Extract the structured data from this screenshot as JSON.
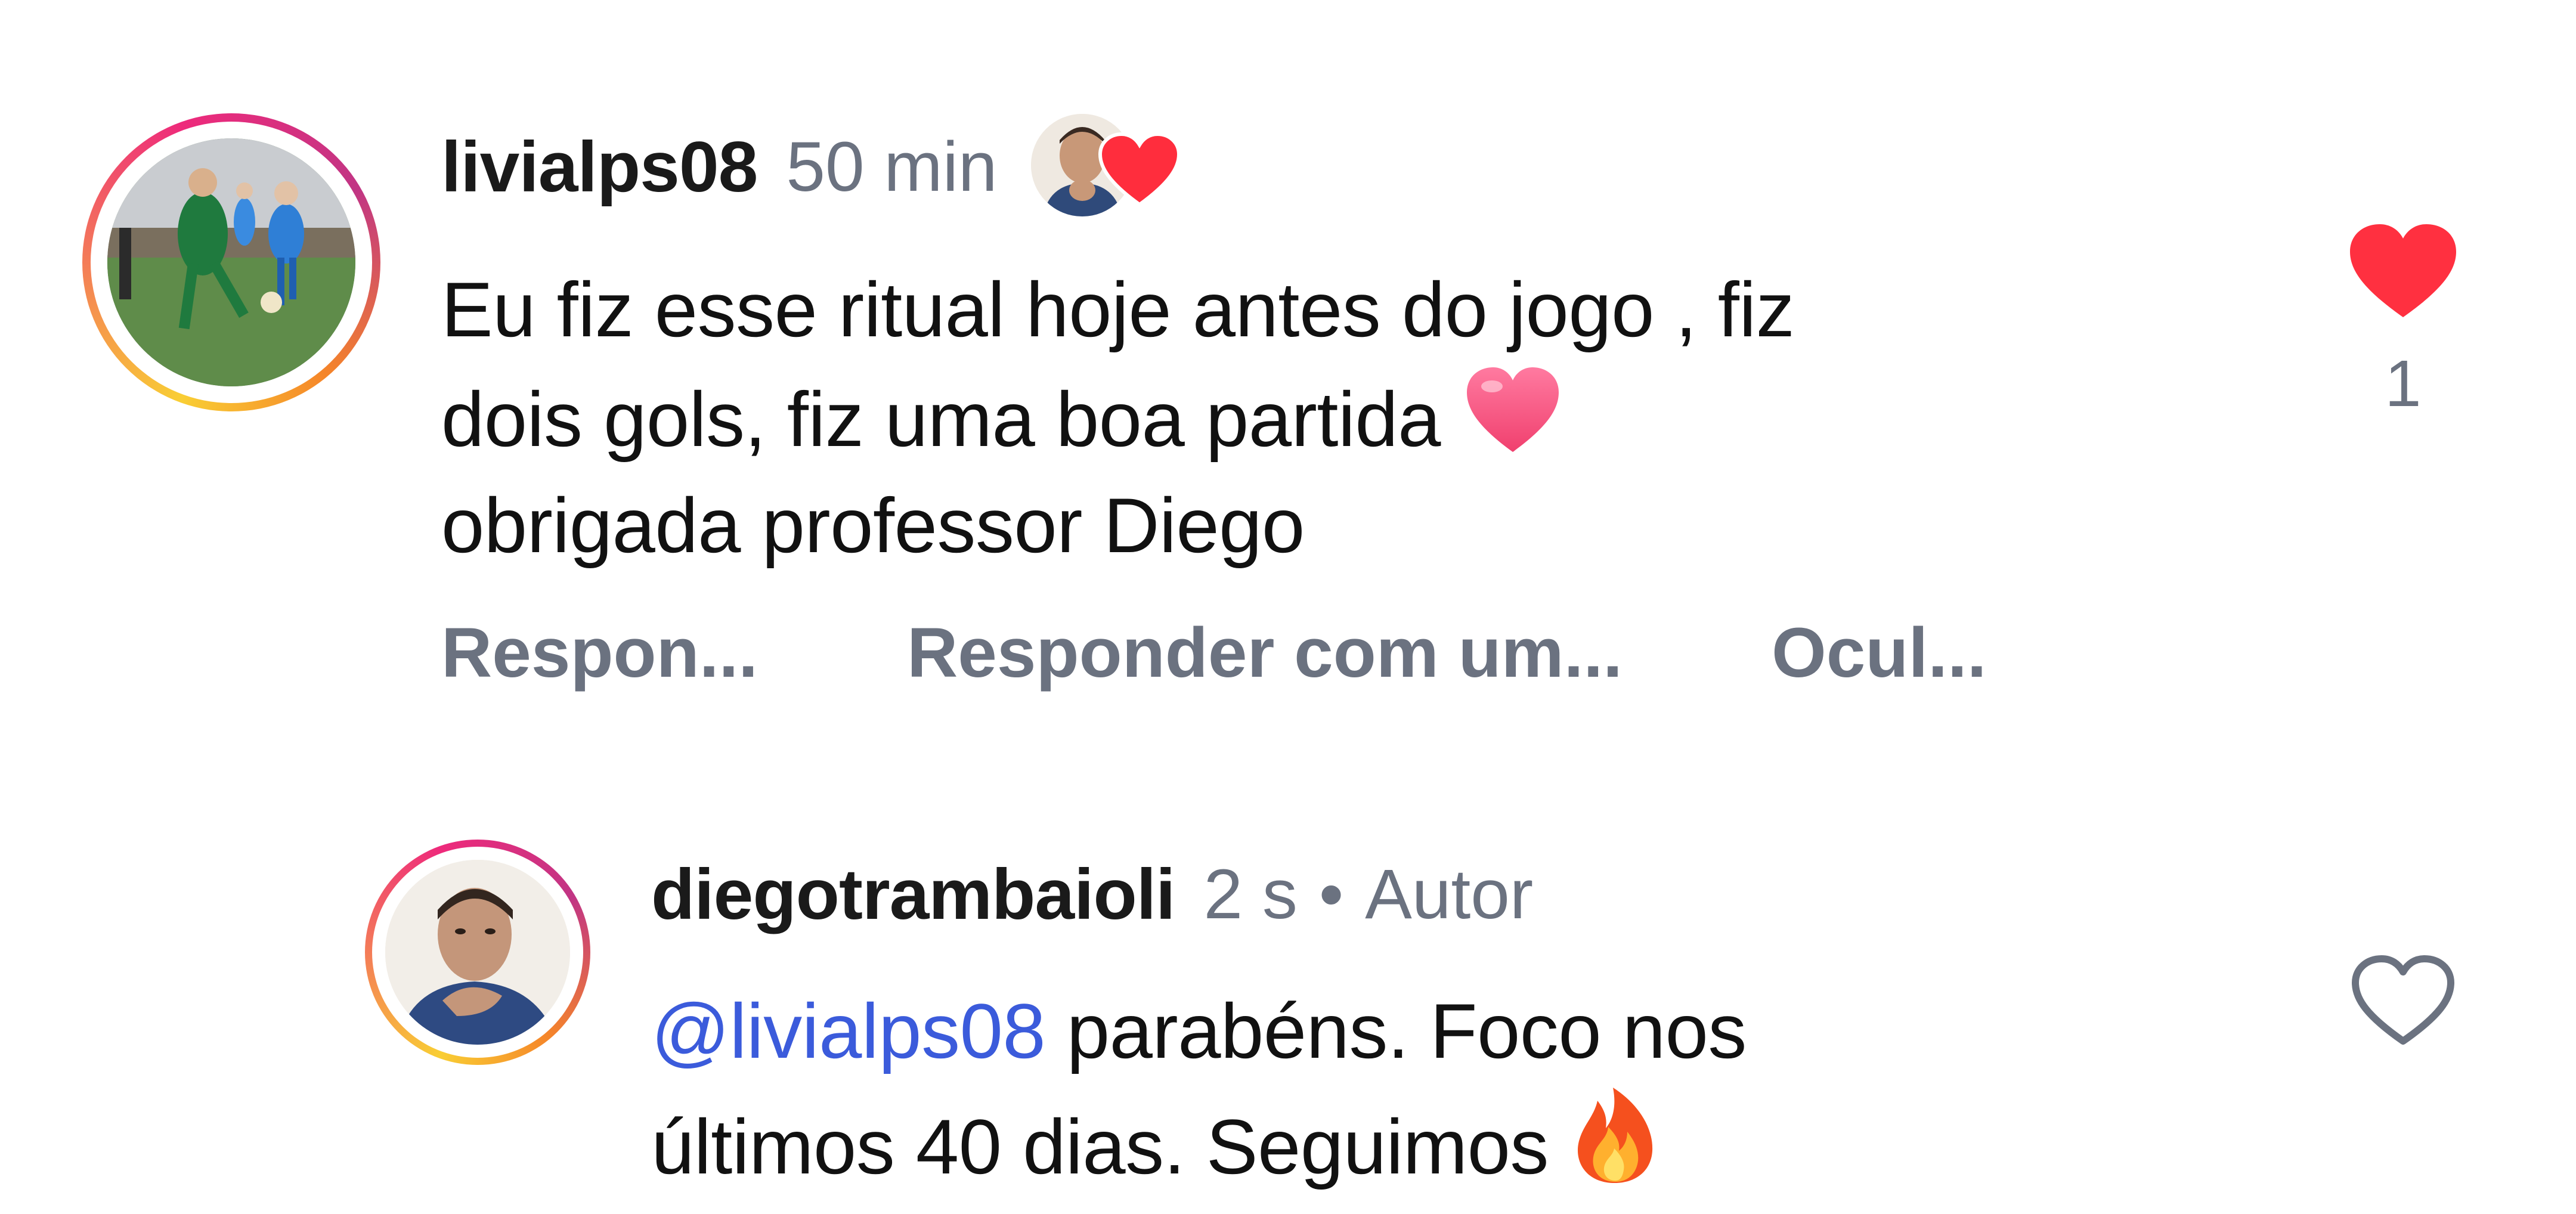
{
  "comments": [
    {
      "username": "livialps08",
      "time": "50 min",
      "text_line1": "Eu fiz esse ritual hoje antes do jogo , fiz",
      "text_line2": "dois gols, fiz uma boa partida",
      "text_line3": "obrigada professor Diego",
      "liked_by_author": true,
      "like_count": "1",
      "liked": true,
      "actions": [
        "Respon...",
        "Responder com um...",
        "Ocul..."
      ]
    },
    {
      "username": "diegotrambaioli",
      "time": "2 s",
      "separator": "•",
      "author_tag": "Autor",
      "mention": "@livialps08",
      "text_after_mention": " parabéns. Foco nos",
      "text_line2": "últimos 40 dias. Seguimos",
      "liked": false
    }
  ],
  "icons": {
    "liked_heart": "heart-filled-icon",
    "unliked_heart": "heart-outline-icon",
    "pink_heart_emoji": "pink-heart-emoji",
    "fire_emoji": "fire-emoji"
  },
  "colors": {
    "like_red": "#ff3040",
    "mention_blue": "#3b5bdb",
    "secondary_text": "#6b7280"
  }
}
